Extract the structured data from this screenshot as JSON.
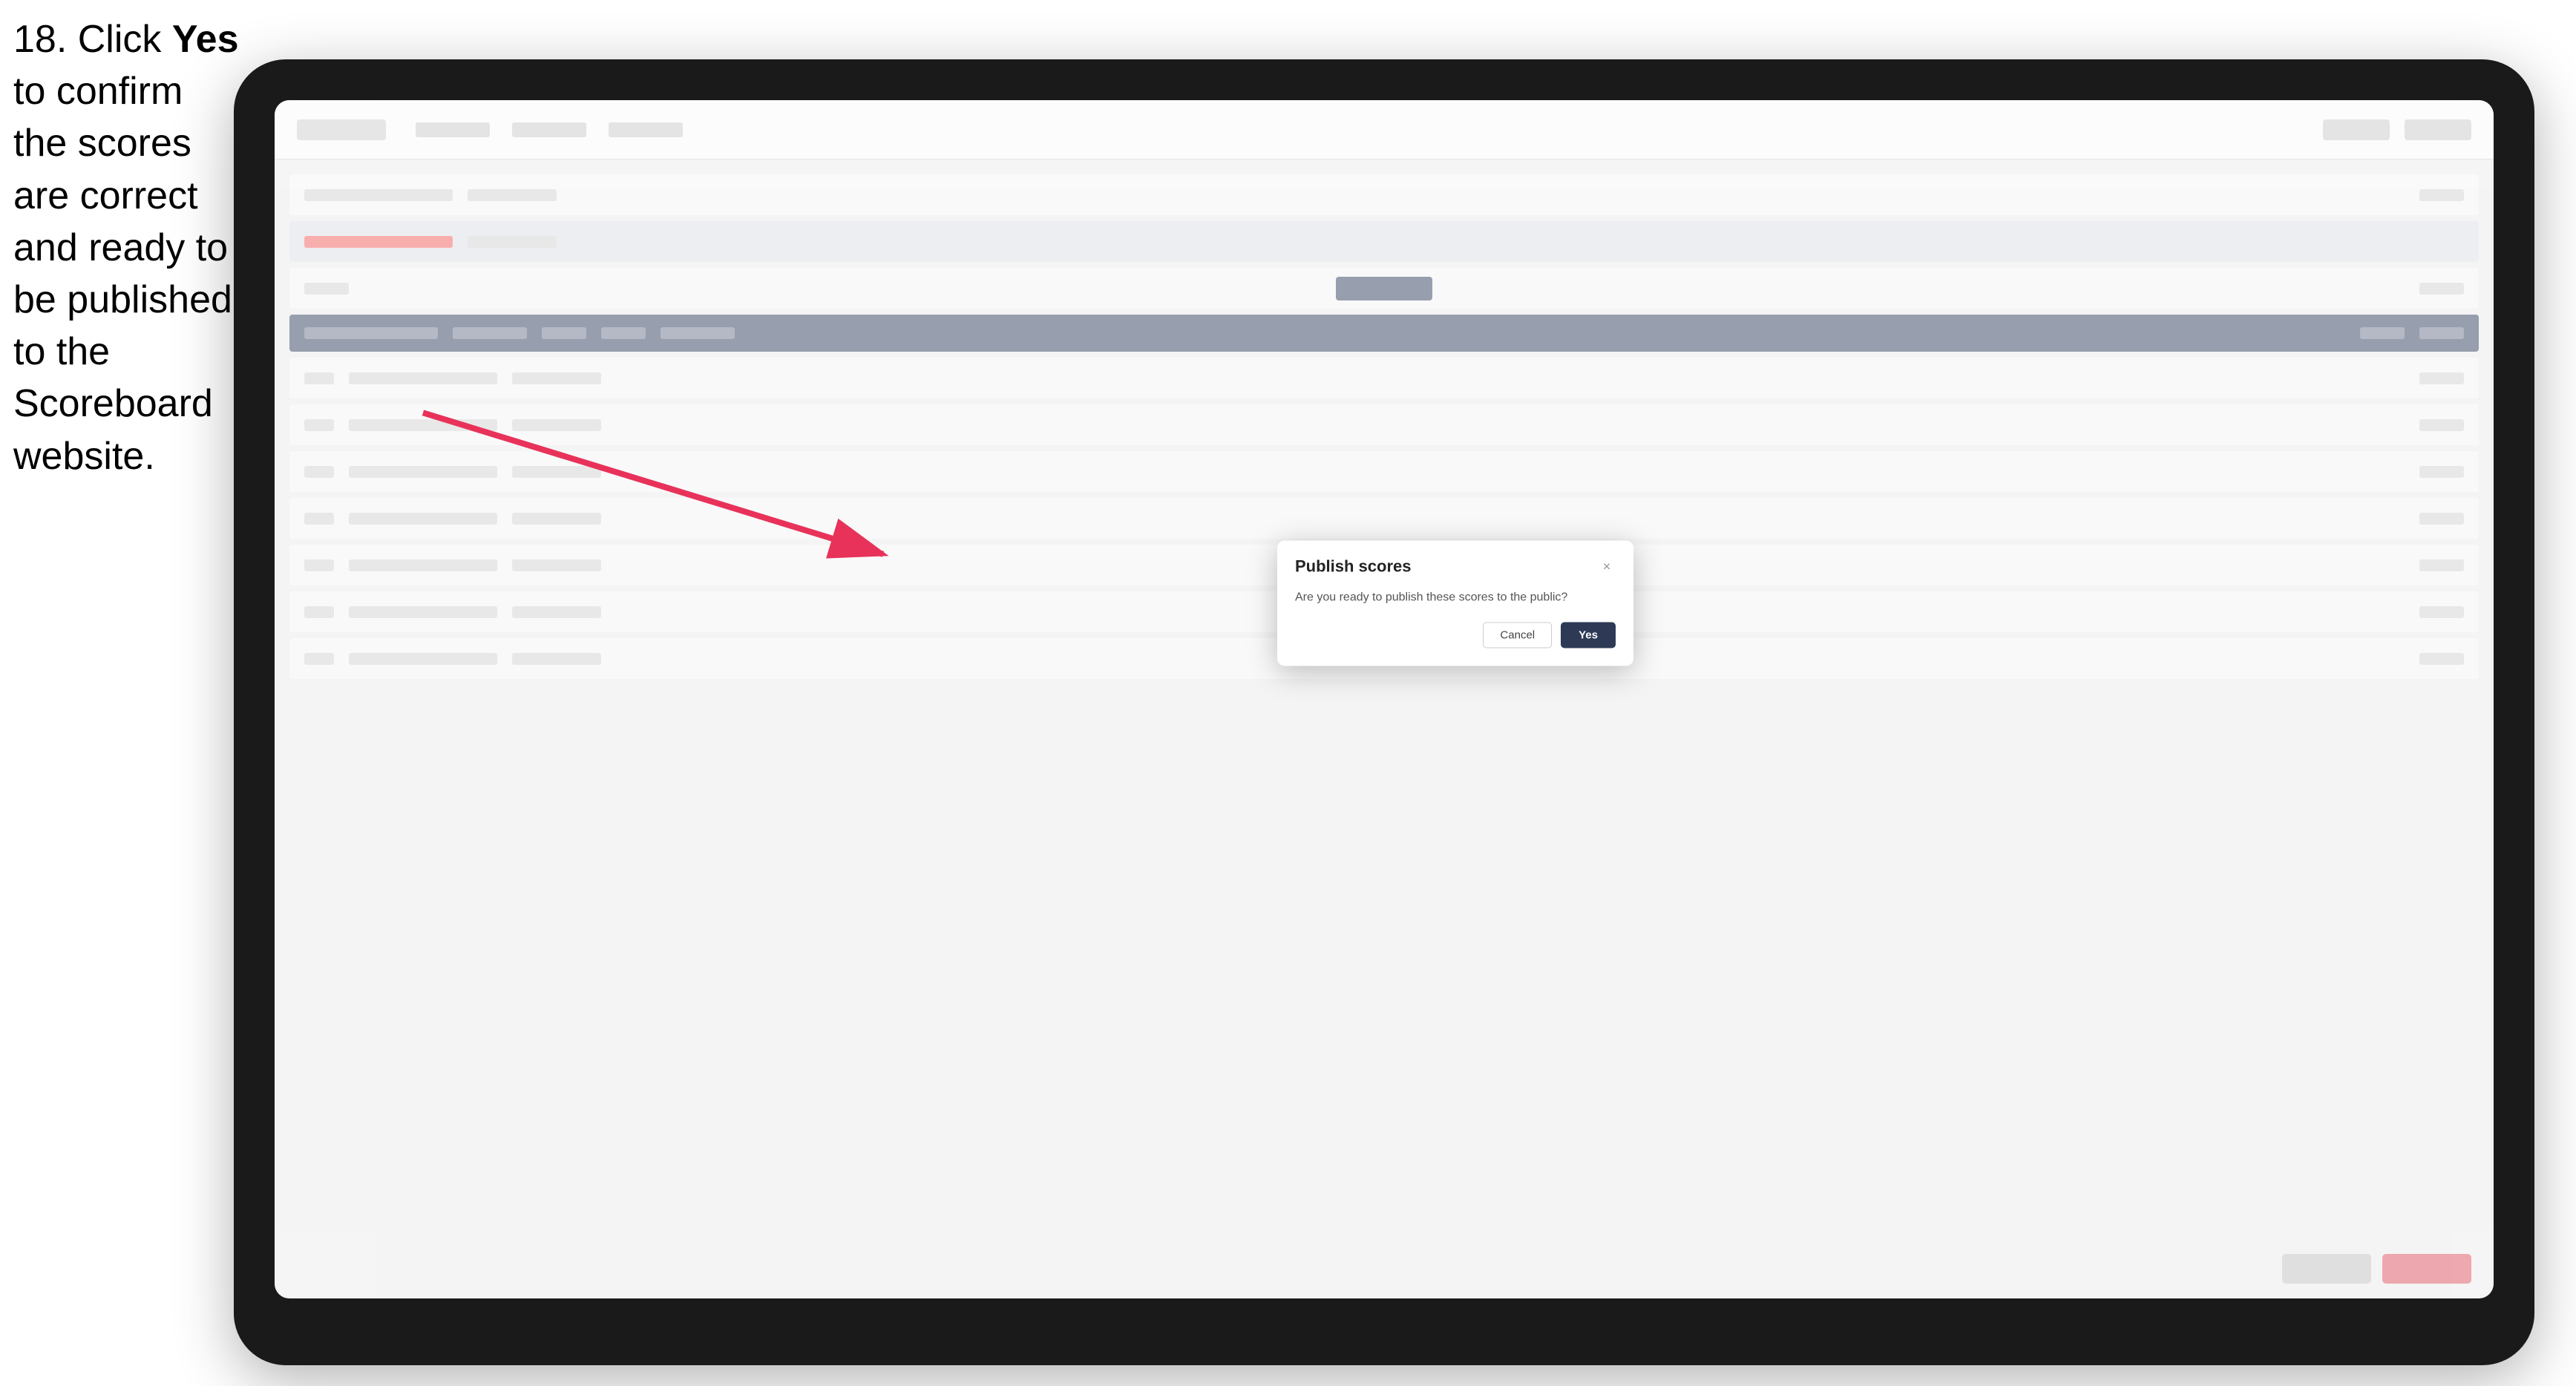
{
  "instruction": {
    "step_number": "18.",
    "text_before_bold": " Click ",
    "bold_word": "Yes",
    "text_after_bold": " to confirm the scores are correct and ready to be published to the Scoreboard website."
  },
  "modal": {
    "title": "Publish scores",
    "message": "Are you ready to publish these scores to the public?",
    "cancel_label": "Cancel",
    "yes_label": "Yes",
    "close_icon": "×"
  },
  "colors": {
    "yes_button_bg": "#2e3a55",
    "arrow_color": "#e8325a"
  }
}
